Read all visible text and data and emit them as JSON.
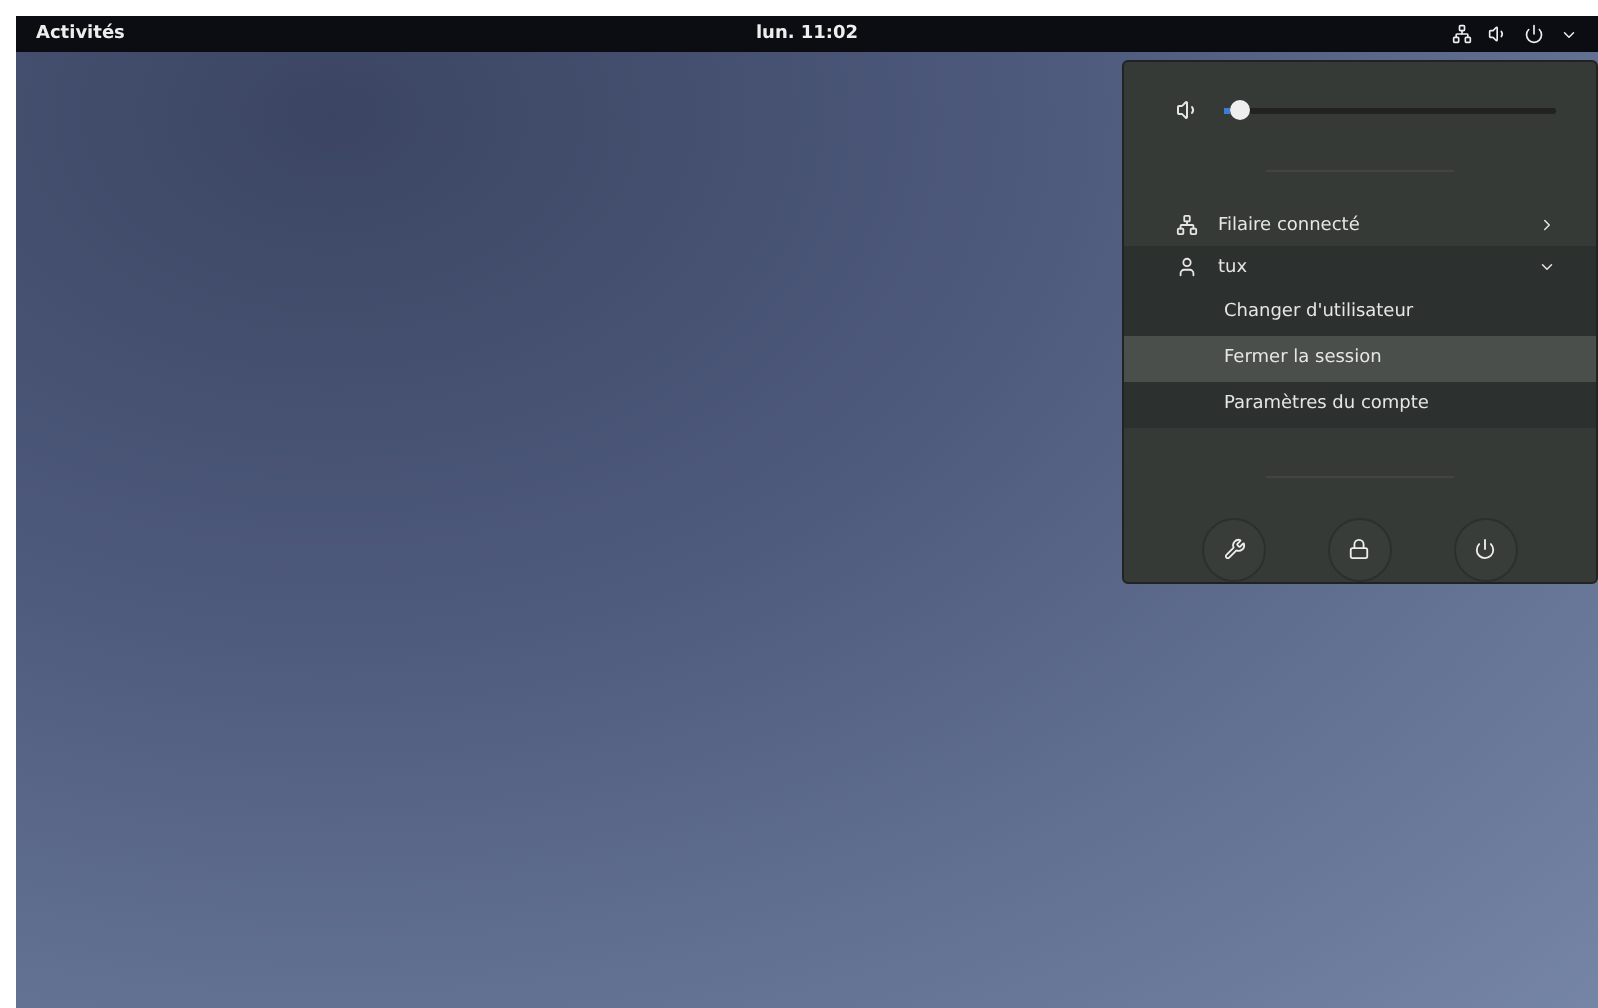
{
  "top_bar": {
    "activities": "Activités",
    "clock": "lun. 11:02"
  },
  "menu": {
    "volume": {
      "level": 0.05
    },
    "network": {
      "label": "Filaire connecté"
    },
    "user": {
      "label": "tux",
      "expanded": true,
      "items": [
        {
          "label": "Changer d'utilisateur",
          "selected": false
        },
        {
          "label": "Fermer la session",
          "selected": true
        },
        {
          "label": "Paramètres du compte",
          "selected": false
        }
      ]
    },
    "actions": [
      {
        "kind": "settings"
      },
      {
        "kind": "lock"
      },
      {
        "kind": "power"
      }
    ]
  }
}
